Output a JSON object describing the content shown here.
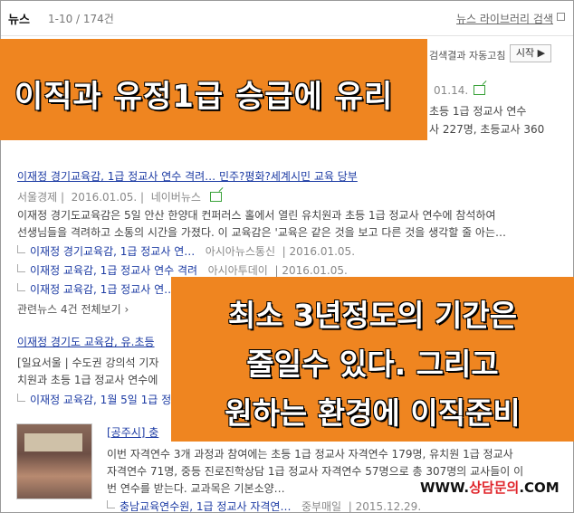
{
  "header": {
    "title": "뉴스",
    "count": "1-10 / 174건",
    "library_link": "뉴스 라이브러리 검색"
  },
  "controls": {
    "auto_label": "검색결과 자동고침",
    "start_button": "시작 ▶"
  },
  "partial": {
    "date": "01.14.",
    "line1": "초등 1급 정교사 연수 ",
    "line2": "사 227명, 초등교사 360"
  },
  "item1": {
    "title": "이재정 경기교육감, 1급 정교사 연수 격려… 민주?평화?세계시민 교육 당부",
    "source": "서울경제",
    "date": "2016.01.05.",
    "portal": "네이버뉴스",
    "body1": "이재정 경기도교육감은 5일 안산 한양대 컨퍼러스 홀에서 열린 유치원과 초등 1급 정교사 연수에 참석하여",
    "body2": "선생님들을 격려하고 소통의 시간을 가졌다. 이 교육감은 '교육은 같은 것을 보고 다른 것을 생각할 줄 아는…",
    "related": [
      {
        "title": "이재정 경기교육감, 1급 정교사 연…",
        "source": "아시아뉴스통신",
        "date": "2016.01.05."
      },
      {
        "title": "이재정 교육감, 1급 정교사 연수 격려",
        "source": "아시아투데이",
        "date": "2016.01.05."
      },
      {
        "title": "이재정 교육감, 1급 정교사 연…",
        "source": "",
        "date": ""
      }
    ],
    "more": "관련뉴스 4건 전체보기 ›"
  },
  "item2": {
    "title": "이재정 경기도 교육감, 유.초등",
    "body1": "[일요서울 | 수도권 강의석 기자",
    "body2": "치원과 초등 1급 정교사 연수에",
    "related": "이재정 교육감, 1월 5일 1급 정"
  },
  "item3": {
    "title": "[공주시] 충",
    "body1": "이번 자격연수 3개 과정과 참여에는 초등 1급 정교사 자격연수 179명, 유치원 1급 정교사",
    "body2": "자격연수 71명, 중등 진로진학상담 1급 정교사 자격연수 57명으로 총 307명의 교사들이 이",
    "body3": "번 연수를 받는다. 교과목은 기본소양…",
    "related": {
      "title": "충남교육연수원, 1급 정교사 자격연…",
      "source": "중부매일",
      "date": "2015.12.29."
    }
  },
  "overlay1": {
    "text": "이직과 유정1급 승급에 유리"
  },
  "overlay2": {
    "line1": "최소 3년정도의 기간은",
    "line2": "줄일수 있다. 그리고",
    "line3": "원하는 환경에 이직준비"
  },
  "watermark": {
    "prefix": "WWW.",
    "brand": "상담문의",
    "suffix": ".COM"
  }
}
